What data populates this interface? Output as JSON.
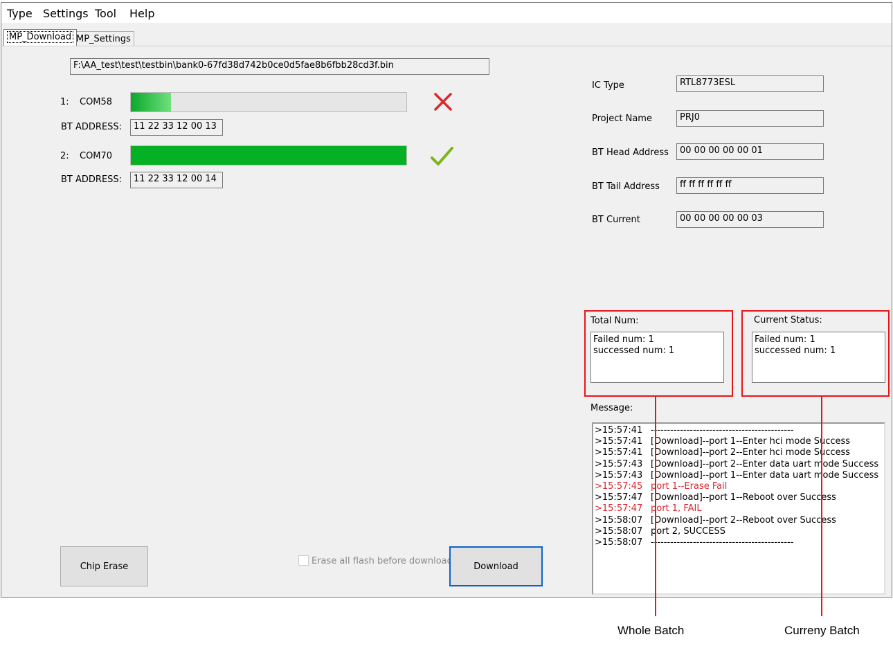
{
  "menu": {
    "type": "Type",
    "settings": "Settings",
    "tool": "Tool",
    "help": "Help"
  },
  "tabs": {
    "download": "MP_Download",
    "settings": "MP_Settings"
  },
  "file_path": "F:\\AA_test\\test\\testbin\\bank0-67fd38d742b0ce0d5fae8b6fbb28cd3f.bin",
  "ports": [
    {
      "index": "1:",
      "com": "COM58",
      "progress": 0.145,
      "bt_address_label": "BT ADDRESS:",
      "bt_address": "11 22 33 12 00 13",
      "status": "fail",
      "status_icon": "cross-icon"
    },
    {
      "index": "2:",
      "com": "COM70",
      "progress": 1.0,
      "bt_address_label": "BT ADDRESS:",
      "bt_address": "11 22 33 12 00 14",
      "status": "success",
      "status_icon": "checkmark-icon"
    }
  ],
  "info": {
    "ic_type_label": "IC Type",
    "ic_type": "RTL8773ESL",
    "project_name_label": "Project Name",
    "project_name": "PRJ0",
    "bt_head_label": "BT Head Address",
    "bt_head": "00 00 00 00 00 01",
    "bt_tail_label": "BT Tail Address",
    "bt_tail": "ff ff ff ff ff ff",
    "bt_current_label": "BT Current",
    "bt_current": "00 00 00 00 00 03"
  },
  "total_num": {
    "title": "Total Num:",
    "failed": "Failed num: 1",
    "successed": "successed num: 1"
  },
  "current_status": {
    "title": "Current Status:",
    "failed": "Failed num: 1",
    "successed": "successed num: 1"
  },
  "message": {
    "title": "Message:",
    "lines": [
      {
        "time": ">15:57:41",
        "text": "--------------------------------------------",
        "error": false
      },
      {
        "time": ">15:57:41",
        "text": "[Download]--port 1--Enter hci mode Success",
        "error": false
      },
      {
        "time": ">15:57:41",
        "text": "[Download]--port 2--Enter hci mode Success",
        "error": false
      },
      {
        "time": ">15:57:43",
        "text": "[Download]--port 2--Enter data uart mode Success",
        "error": false
      },
      {
        "time": ">15:57:43",
        "text": "[Download]--port 1--Enter data uart mode Success",
        "error": false
      },
      {
        "time": ">15:57:45",
        "text": "port 1--Erase Fail",
        "error": true
      },
      {
        "time": ">15:57:47",
        "text": "[Download]--port 1--Reboot over Success",
        "error": false
      },
      {
        "time": ">15:57:47",
        "text": "port 1, FAIL",
        "error": true
      },
      {
        "time": ">15:58:07",
        "text": "[Download]--port 2--Reboot over Success",
        "error": false
      },
      {
        "time": ">15:58:07",
        "text": "port 2, SUCCESS",
        "error": false
      },
      {
        "time": ">15:58:07",
        "text": "--------------------------------------------",
        "error": false
      }
    ]
  },
  "buttons": {
    "chip_erase": "Chip Erase",
    "download": "Download"
  },
  "erase_all": {
    "label": "Erase all flash before download",
    "checked": false
  },
  "annotations": {
    "whole_batch": "Whole Batch",
    "current_batch": "Curreny Batch"
  },
  "colors": {
    "highlight": "#e8141b",
    "progress_green": "#06b025",
    "fail_red": "#d9282e",
    "check_green": "#7cb518"
  }
}
